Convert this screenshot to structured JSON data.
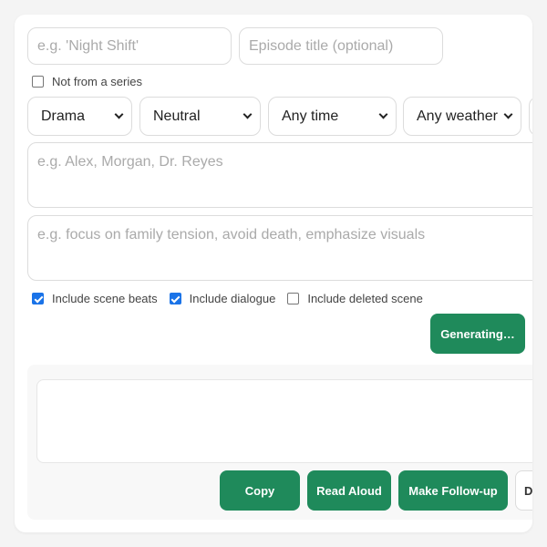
{
  "form": {
    "series_placeholder": "e.g. 'Night Shift'",
    "episode_placeholder": "Episode title (optional)",
    "not_series_label": "Not from a series",
    "not_series_checked": false,
    "genre": "Drama",
    "tone": "Neutral",
    "time": "Any time",
    "weather": "Any weather",
    "characters_placeholder": "e.g. Alex, Morgan, Dr. Reyes",
    "notes_placeholder": "e.g. focus on family tension, avoid death, emphasize visuals",
    "options": [
      {
        "label": "Include scene beats",
        "checked": true
      },
      {
        "label": "Include dialogue",
        "checked": true
      },
      {
        "label": "Include deleted scene",
        "checked": false
      }
    ],
    "generate_label": "Generating…"
  },
  "output": {
    "text": "",
    "actions": {
      "copy": "Copy",
      "read_aloud": "Read Aloud",
      "follow_up": "Make Follow-up",
      "partial": "D"
    }
  },
  "colors": {
    "accent": "#1f8a5b",
    "checkbox": "#1a73e8"
  }
}
